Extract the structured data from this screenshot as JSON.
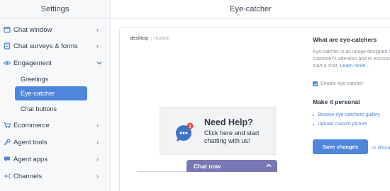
{
  "sidebar": {
    "title": "Settings",
    "items": [
      {
        "label": "Chat window",
        "icon": "window-icon"
      },
      {
        "label": "Chat surveys & forms",
        "icon": "form-icon"
      },
      {
        "label": "Engagement",
        "icon": "eye-icon"
      },
      {
        "label": "Ecommerce",
        "icon": "cart-icon"
      },
      {
        "label": "Agent tools",
        "icon": "wrench-icon"
      },
      {
        "label": "Agent apps",
        "icon": "chat-bubble-icon"
      },
      {
        "label": "Channels",
        "icon": "channels-icon"
      }
    ],
    "engagement_sub": [
      {
        "label": "Greetings"
      },
      {
        "label": "Eye-catcher"
      },
      {
        "label": "Chat buttons"
      }
    ]
  },
  "main": {
    "title": "Eye-catcher"
  },
  "preview": {
    "toggle_desktop": "desktop",
    "toggle_separator": "|",
    "toggle_mobile": "mobile",
    "eyecatcher_title": "Need Help?",
    "eyecatcher_text": "Click here and start chatting with us!",
    "notification_count": "1",
    "chat_bar_label": "Chat now"
  },
  "panel": {
    "heading": "What are eye-catchers",
    "description": "Eye-catcher is an image designed to grab customer's attention and to encourage them to start a chat.",
    "learn_more": "Learn more...",
    "enable_label": "Enable eye-catcher",
    "enable_checked": true,
    "make_personal": "Make it personal",
    "links": [
      {
        "label": "Browse eye-catchers gallery"
      },
      {
        "label": "Upload custom picture"
      }
    ],
    "save_label": "Save changes",
    "or_label": "or",
    "discard_label": "discard"
  },
  "colors": {
    "accent": "#4e86dc",
    "chat_bar": "#7a78b4",
    "sidebar_bg": "#f6f8fa",
    "badge": "#e2434b"
  }
}
